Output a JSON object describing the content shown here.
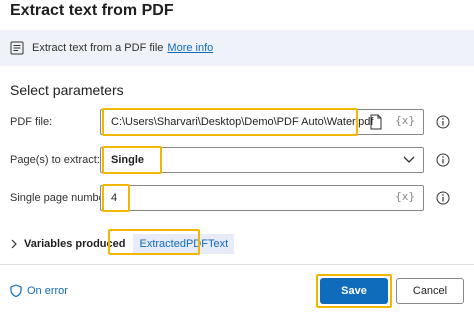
{
  "dialog": {
    "title": "Extract text from PDF"
  },
  "info": {
    "description": "Extract text from a PDF file",
    "link_label": "More info"
  },
  "section": {
    "title": "Select parameters"
  },
  "fields": {
    "pdf_file": {
      "label": "PDF file:",
      "value": "C:\\Users\\Sharvari\\Desktop\\Demo\\PDF Auto\\Water.pdf",
      "var_label": "{x}"
    },
    "pages": {
      "label": "Page(s) to extract:",
      "value": "Single"
    },
    "single_page": {
      "label": "Single page number:",
      "value": "4",
      "var_label": "{x}"
    }
  },
  "variables": {
    "label": "Variables produced",
    "items": [
      "ExtractedPDFText"
    ]
  },
  "footer": {
    "on_error_label": "On error",
    "save_label": "Save",
    "cancel_label": "Cancel"
  },
  "colors": {
    "accent": "#0f6cbd",
    "highlight": "#f2b705",
    "info_bar": "#eff3f9"
  }
}
